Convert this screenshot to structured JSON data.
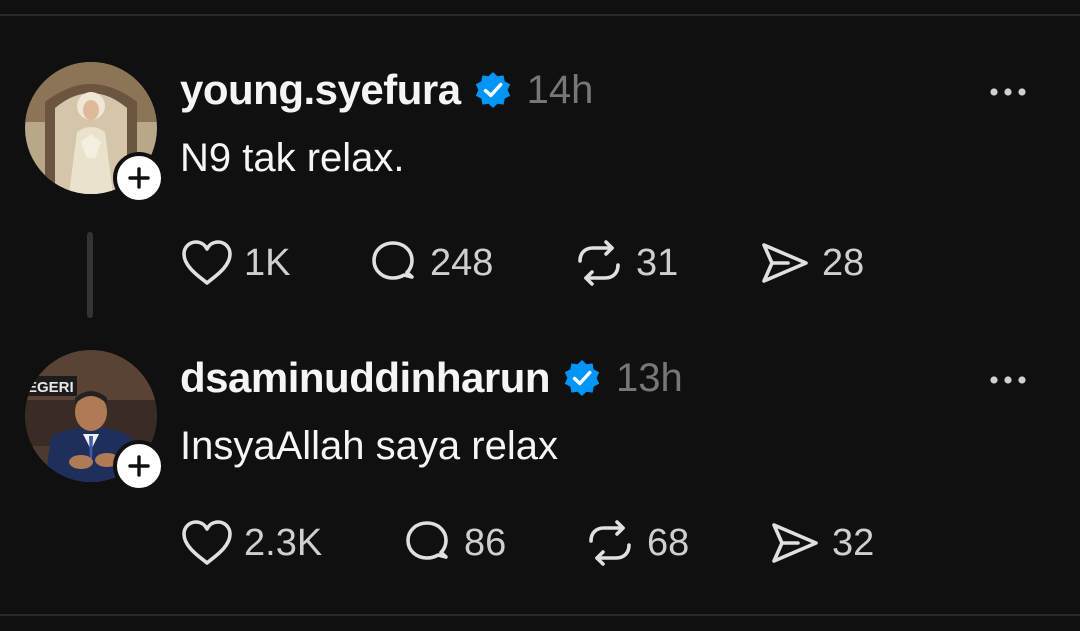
{
  "posts": [
    {
      "username": "young.syefura",
      "time": "14h",
      "text": "N9 tak relax.",
      "likes": "1K",
      "replies": "248",
      "reposts": "31",
      "shares": "28"
    },
    {
      "username": "dsaminuddinharun",
      "time": "13h",
      "text": "InsyaAllah saya relax",
      "likes": "2.3K",
      "replies": "86",
      "reposts": "68",
      "shares": "32"
    }
  ],
  "avatar_sign_text": "EGERI",
  "icons": [
    "plus-icon",
    "verified-badge-icon",
    "more-icon",
    "heart-icon",
    "reply-icon",
    "repost-icon",
    "share-icon"
  ],
  "colors": {
    "background": "#101010",
    "text": "#f3f5f7",
    "muted": "#777777",
    "verified": "#0095f6"
  }
}
